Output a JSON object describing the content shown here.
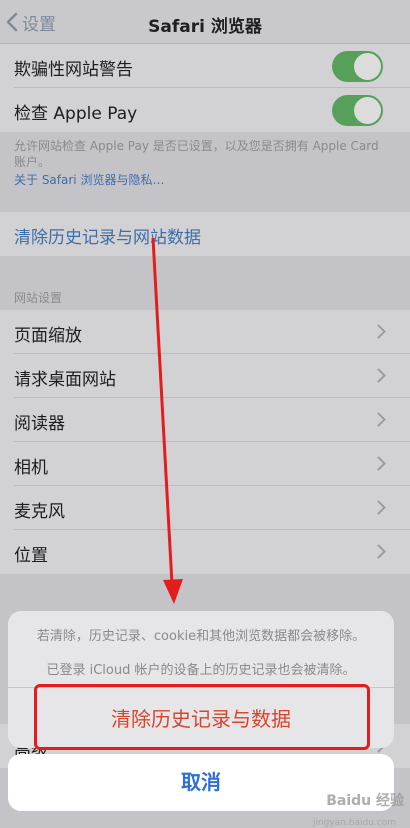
{
  "nav": {
    "back_label": "设置",
    "title": "Safari 浏览器"
  },
  "toggles": [
    {
      "label": "欺骗性网站警告",
      "on": true
    },
    {
      "label": "检查 Apple Pay",
      "on": true
    }
  ],
  "footnote": "允许网站检查 Apple Pay 是否已设置，以及您是否拥有 Apple Card 账户。",
  "privacy_link": "关于 Safari 浏览器与隐私…",
  "clear_row": "清除历史记录与网站数据",
  "website_settings": {
    "header": "网站设置",
    "items": [
      "页面缩放",
      "请求桌面网站",
      "阅读器",
      "相机",
      "麦克风",
      "位置"
    ]
  },
  "partial_row": "高级",
  "sheet": {
    "message_1": "若清除，历史记录、cookie和其他浏览数据都会被移除。",
    "message_2": "已登录 iCloud 帐户的设备上的历史记录也会被清除。",
    "destructive": "清除历史记录与数据",
    "cancel": "取消"
  },
  "colors": {
    "toggle_on": "#56a05a",
    "link": "#3e6ea8",
    "destructive": "#d6452f",
    "cancel": "#2d6fd6",
    "annotation": "#e31d1d"
  },
  "watermark": {
    "brand": "Baidu 经验",
    "url": "jingyan.baidu.com"
  }
}
